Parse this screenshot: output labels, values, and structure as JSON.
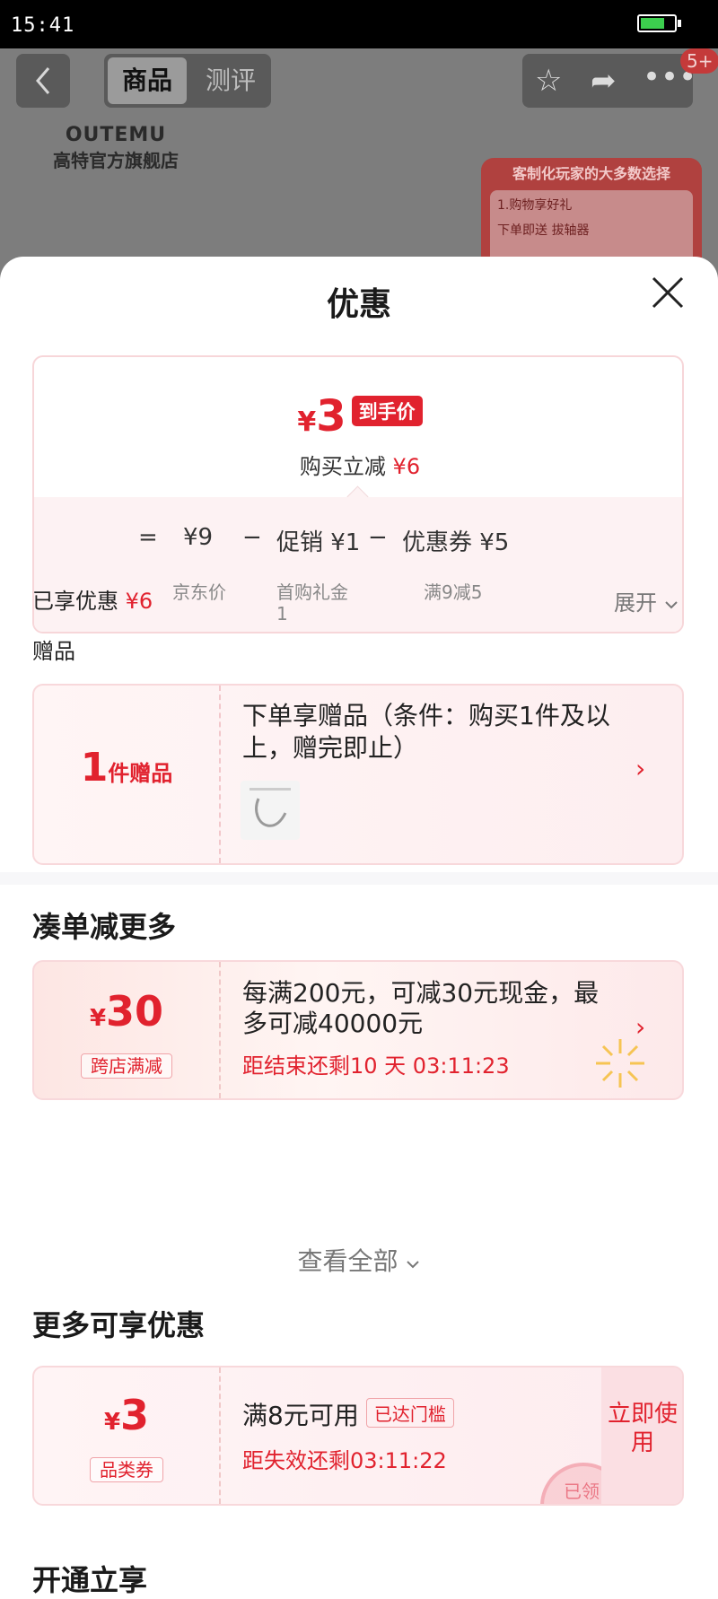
{
  "status_bar": {
    "time": "15:41"
  },
  "background_page": {
    "tabs": [
      "商品",
      "测评"
    ],
    "badge": "5+",
    "brand_en": "OUTEMU",
    "brand_cn": "高特官方旗舰店",
    "ad_title": "客制化玩家的大多数选择",
    "ad_line1": "1.购物享好礼",
    "ad_line2": "下单即送 拔轴器"
  },
  "sheet": {
    "title": "优惠",
    "summary": {
      "currency": "¥",
      "final_price": "3",
      "final_tag": "到手价",
      "save_label": "购买立减",
      "save_amount": "¥6",
      "formula": {
        "equals": "=",
        "base": "¥9",
        "base_sub": "京东价",
        "minus1": "−",
        "promo": "促销 ¥1",
        "promo_sub": "首购礼金",
        "promo_sub2": "1",
        "minus2": "−",
        "coupon": "优惠券 ¥5",
        "coupon_sub": "满9减5"
      }
    },
    "enjoyed_label": "已享优惠",
    "enjoyed_amount": "¥6",
    "expand_label": "展开",
    "gift_section": "赠品",
    "gift": {
      "count": "1",
      "count_unit": "件赠品",
      "desc": "下单享赠品（条件：购买1件及以上，赠完即止）"
    },
    "bundle_title": "凑单减更多",
    "bundle": {
      "currency": "¥",
      "amount": "30",
      "tag": "跨店满减",
      "text": "每满200元，可减30元现金，最多可减40000元",
      "countdown": "距结束还剩10 天 03:11:23"
    },
    "view_all": "查看全部",
    "more_title": "更多可享优惠",
    "coupon": {
      "currency": "¥",
      "amount": "3",
      "tag": "品类券",
      "cond": "满8元可用",
      "reached": "已达门槛",
      "countdown": "距失效还剩03:11:22",
      "use": "立即使用",
      "stamp": "已领"
    },
    "next_section": "开通立享"
  },
  "colors": {
    "accent": "#e1222e",
    "pink_bg": "#fdf2f3"
  }
}
